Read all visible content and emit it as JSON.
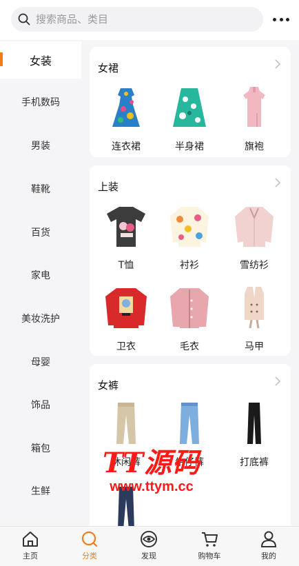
{
  "search": {
    "placeholder": "搜索商品、类目"
  },
  "sidebar": {
    "items": [
      {
        "label": "女装",
        "active": true
      },
      {
        "label": "手机数码"
      },
      {
        "label": "男装"
      },
      {
        "label": "鞋靴"
      },
      {
        "label": "百货"
      },
      {
        "label": "家电"
      },
      {
        "label": "美妆洗护"
      },
      {
        "label": "母婴"
      },
      {
        "label": "饰品"
      },
      {
        "label": "箱包"
      },
      {
        "label": "生鲜"
      }
    ]
  },
  "sections": [
    {
      "title": "女裙",
      "items": [
        {
          "label": "连衣裙",
          "icon": "floral-dress-icon"
        },
        {
          "label": "半身裙",
          "icon": "skirt-icon"
        },
        {
          "label": "旗袍",
          "icon": "qipao-icon"
        }
      ]
    },
    {
      "title": "上装",
      "items": [
        {
          "label": "T恤",
          "icon": "tshirt-icon"
        },
        {
          "label": "衬衫",
          "icon": "shirt-icon"
        },
        {
          "label": "雪纺衫",
          "icon": "chiffon-blouse-icon"
        },
        {
          "label": "卫衣",
          "icon": "sweatshirt-icon"
        },
        {
          "label": "毛衣",
          "icon": "cardigan-icon"
        },
        {
          "label": "马甲",
          "icon": "vest-icon"
        }
      ]
    },
    {
      "title": "女裤",
      "items": [
        {
          "label": "休闲裤",
          "icon": "casual-pants-icon"
        },
        {
          "label": "牛仔裤",
          "icon": "jeans-icon"
        },
        {
          "label": "打底裤",
          "icon": "leggings-icon"
        }
      ]
    }
  ],
  "watermark": {
    "logo": "TT源码",
    "url": "www.ttym.cc"
  },
  "tabbar": {
    "tabs": [
      {
        "label": "主页",
        "icon": "home-icon"
      },
      {
        "label": "分类",
        "icon": "category-search-icon",
        "active": true
      },
      {
        "label": "发现",
        "icon": "eye-icon"
      },
      {
        "label": "购物车",
        "icon": "cart-icon"
      },
      {
        "label": "我的",
        "icon": "profile-icon"
      }
    ]
  },
  "colors": {
    "accent": "#f07d1a",
    "watermark": "#ff1a1a"
  }
}
